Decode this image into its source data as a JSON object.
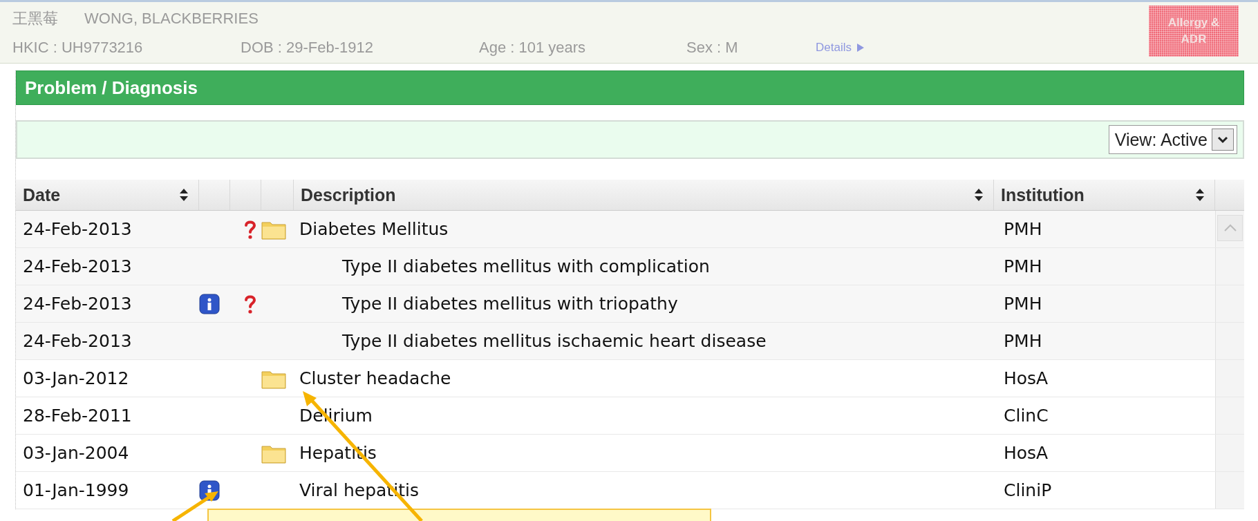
{
  "patient": {
    "name_local": "王黑莓",
    "name": "WONG, BLACKBERRIES",
    "hkic": "HKIC : UH9773216",
    "dob": "DOB : 29-Feb-1912",
    "age": "Age : 101 years",
    "sex": "Sex : M",
    "details_link": "Details",
    "allergy_button": [
      "Allergy &",
      "ADR"
    ]
  },
  "panel": {
    "title": "Problem / Diagnosis",
    "view_select": {
      "value": "View: Active"
    }
  },
  "table": {
    "columns": [
      {
        "label": "Date"
      },
      {
        "label": "Description"
      },
      {
        "label": "Institution"
      }
    ],
    "rows": [
      {
        "date": "24-Feb-2013",
        "info": false,
        "unconfirmed": true,
        "folder": true,
        "description": "Diabetes Mellitus",
        "institution": "PMH",
        "children": [
          {
            "date": "24-Feb-2013",
            "info": false,
            "unconfirmed": false,
            "folder": false,
            "description": "Type II diabetes mellitus with complication",
            "institution": "PMH"
          },
          {
            "date": "24-Feb-2013",
            "info": true,
            "unconfirmed": true,
            "folder": false,
            "description": "Type II diabetes mellitus with triopathy",
            "institution": "PMH"
          },
          {
            "date": "24-Feb-2013",
            "info": false,
            "unconfirmed": false,
            "folder": false,
            "description": "Type II diabetes mellitus ischaemic heart disease",
            "institution": "PMH"
          }
        ]
      },
      {
        "date": "03-Jan-2012",
        "info": false,
        "unconfirmed": false,
        "folder": true,
        "description": "Cluster headache",
        "institution": "HosA"
      },
      {
        "date": "28-Feb-2011",
        "info": false,
        "unconfirmed": false,
        "folder": false,
        "description": "Delirium",
        "institution": "ClinC"
      },
      {
        "date": "03-Jan-2004",
        "info": false,
        "unconfirmed": false,
        "folder": true,
        "description": "Hepatitis",
        "institution": "HosA"
      },
      {
        "date": "01-Jan-1999",
        "info": true,
        "unconfirmed": false,
        "folder": false,
        "description": "Viral hepatitis",
        "institution": "CliniP"
      }
    ]
  }
}
